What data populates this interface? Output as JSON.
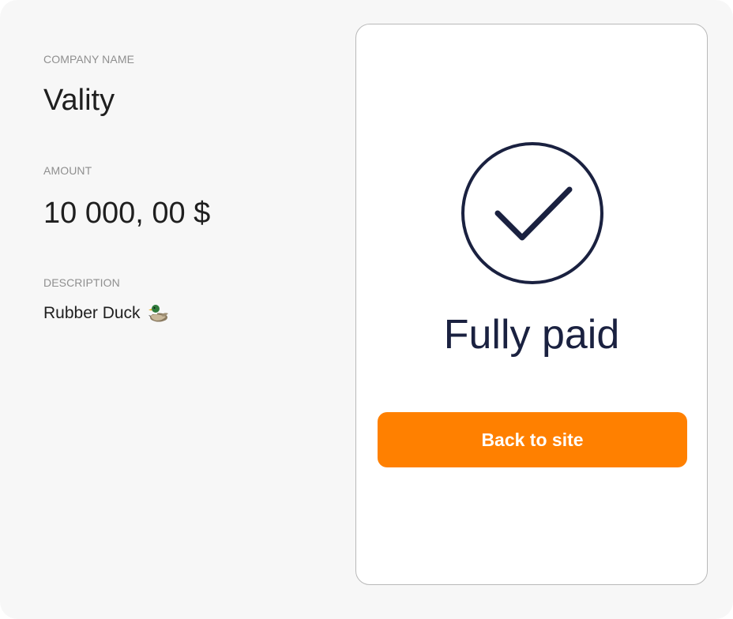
{
  "company": {
    "label": "COMPANY NAME",
    "name": "Vality"
  },
  "amount": {
    "label": "AMOUNT",
    "value": "10 000, 00 $"
  },
  "description": {
    "label": "DESCRIPTION",
    "value": "Rubber Duck",
    "icon": "duck-icon"
  },
  "status": {
    "icon": "checkmark-circle-icon",
    "title": "Fully paid"
  },
  "actions": {
    "back_label": "Back to site"
  },
  "colors": {
    "accent": "#ff8000",
    "status_text": "#1a2140",
    "background": "#f7f7f7"
  }
}
